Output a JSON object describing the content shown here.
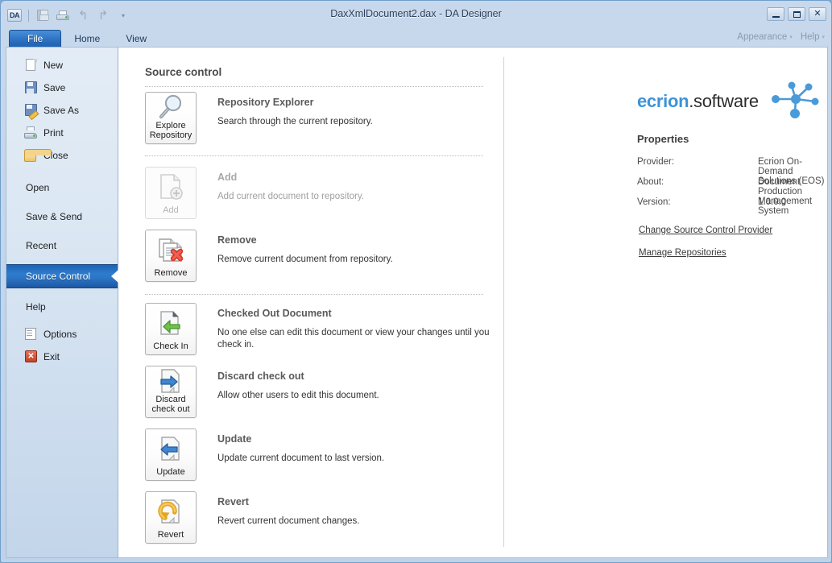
{
  "window": {
    "title": "DaxXmlDocument2.dax -  DA Designer",
    "minimize_label": "Minimize",
    "maximize_label": "Maximize",
    "close_label": "✕"
  },
  "quick_access": {
    "app_logo": "DA",
    "items": [
      {
        "name": "save-icon",
        "label": "Save",
        "enabled": false
      },
      {
        "name": "print-icon",
        "label": "Print",
        "enabled": true
      },
      {
        "name": "undo-icon",
        "label": "Undo",
        "glyph": "↰",
        "enabled": false
      },
      {
        "name": "redo-icon",
        "label": "Redo",
        "glyph": "↱",
        "enabled": false
      },
      {
        "name": "customize-quick-access-icon",
        "label": "Customize Quick Access Toolbar",
        "glyph": "▾",
        "enabled": true
      }
    ]
  },
  "ribbon": {
    "tabs": [
      {
        "label": "File",
        "active": true
      },
      {
        "label": "Home",
        "active": false
      },
      {
        "label": "View",
        "active": false
      }
    ],
    "right_menu": [
      {
        "label": "Appearance",
        "caret": "▾"
      },
      {
        "label": "Help",
        "caret": "▾"
      }
    ]
  },
  "sidebar": {
    "items": [
      {
        "label": "New",
        "icon": "new-document-icon",
        "active": false,
        "has_icon": true
      },
      {
        "label": "Save",
        "icon": "save-icon",
        "active": false,
        "has_icon": true
      },
      {
        "label": "Save As",
        "icon": "save-as-icon",
        "active": false,
        "has_icon": true
      },
      {
        "label": "Print",
        "icon": "print-icon",
        "active": false,
        "has_icon": true
      },
      {
        "label": "Close",
        "icon": "close-folder-icon",
        "active": false,
        "has_icon": true
      },
      {
        "label": "Open",
        "icon": null,
        "active": false,
        "has_icon": false
      },
      {
        "label": "Save & Send",
        "icon": null,
        "active": false,
        "has_icon": false
      },
      {
        "label": "Recent",
        "icon": null,
        "active": false,
        "has_icon": false
      },
      {
        "label": "Source Control",
        "icon": null,
        "active": true,
        "has_icon": false
      },
      {
        "label": "Help",
        "icon": null,
        "active": false,
        "has_icon": false
      },
      {
        "label": "Options",
        "icon": "options-icon",
        "active": false,
        "has_icon": true
      },
      {
        "label": "Exit",
        "icon": "exit-icon",
        "active": false,
        "has_icon": true
      }
    ]
  },
  "main": {
    "heading": "Source control",
    "commands": [
      {
        "button_caption": [
          "Explore",
          "Repository"
        ],
        "icon": "magnifier-icon",
        "title": "Repository Explorer",
        "description": "Search through the current repository.",
        "enabled": true
      },
      {
        "button_caption": [
          "Add"
        ],
        "icon": "document-add-icon",
        "title": "Add",
        "description": "Add current document to repository.",
        "enabled": false
      },
      {
        "button_caption": [
          "Remove"
        ],
        "icon": "documents-delete-icon",
        "title": "Remove",
        "description": "Remove current document from repository.",
        "enabled": true
      },
      {
        "button_caption": [
          "Check In"
        ],
        "icon": "document-check-in-icon",
        "title": "Checked Out Document",
        "description": "No one else can edit this document or view your changes until you check in.",
        "enabled": true
      },
      {
        "button_caption": [
          "Discard",
          "check out"
        ],
        "icon": "document-discard-icon",
        "title": "Discard check out",
        "description": "Allow other users to edit this document.",
        "enabled": true
      },
      {
        "button_caption": [
          "Update"
        ],
        "icon": "document-update-icon",
        "title": "Update",
        "description": "Update current document to last version.",
        "enabled": true
      },
      {
        "button_caption": [
          "Revert"
        ],
        "icon": "document-revert-icon",
        "title": "Revert",
        "description": "Revert current document changes.",
        "enabled": true
      }
    ]
  },
  "info_panel": {
    "logo_text_primary": "ecrion",
    "logo_text_secondary": ".software",
    "logo_icon": "network-nodes-icon",
    "properties_heading": "Properties",
    "properties": [
      {
        "label": "Provider:",
        "value": "Ecrion On-Demand Solutions (EOS)"
      },
      {
        "label": "About:",
        "value": "Document Production Management System"
      },
      {
        "label": "Version:",
        "value": "1.0.0.0"
      }
    ],
    "links": [
      {
        "label": "Change Source Control Provider"
      },
      {
        "label": "Manage Repositories"
      }
    ]
  },
  "colors": {
    "accent_blue": "#2f74c4",
    "logo_blue": "#3d93d8",
    "title_bar": "#c5d5ea",
    "selected_item": "#1f63b4"
  }
}
